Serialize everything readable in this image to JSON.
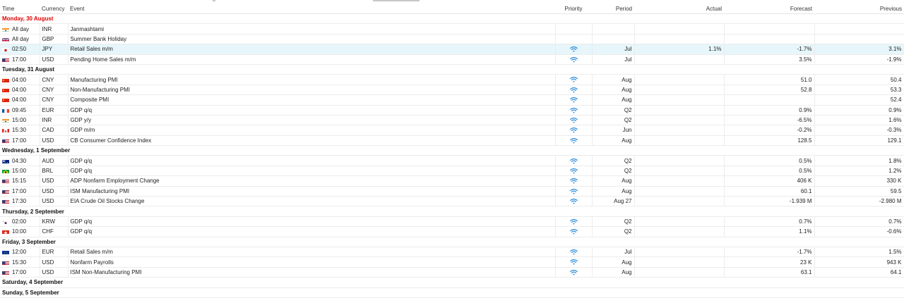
{
  "columns": {
    "time": "Time",
    "currency": "Currency",
    "event": "Event",
    "priority": "Priority",
    "period": "Period",
    "actual": "Actual",
    "forecast": "Forecast",
    "previous": "Previous"
  },
  "days": [
    {
      "label": "Monday, 30 August",
      "today": true,
      "events": [
        {
          "flag": "india",
          "time": "All day",
          "currency": "INR",
          "event": "Janmashtami",
          "priority": "",
          "period": "",
          "actual": "",
          "forecast": "",
          "previous": ""
        },
        {
          "flag": "uk",
          "time": "All day",
          "currency": "GBP",
          "event": "Summer Bank Holiday",
          "priority": "",
          "period": "",
          "actual": "",
          "forecast": "",
          "previous": ""
        },
        {
          "flag": "japan",
          "time": "02:50",
          "currency": "JPY",
          "event": "Retail Sales m/m",
          "priority": "high",
          "period": "Jul",
          "actual": "1.1%",
          "forecast": "-1.7%",
          "previous": "3.1%",
          "selected": true
        },
        {
          "flag": "usa",
          "time": "17:00",
          "currency": "USD",
          "event": "Pending Home Sales m/m",
          "priority": "high",
          "period": "Jul",
          "actual": "",
          "forecast": "3.5%",
          "previous": "-1.9%"
        }
      ]
    },
    {
      "label": "Tuesday, 31 August",
      "events": [
        {
          "flag": "china",
          "time": "04:00",
          "currency": "CNY",
          "event": "Manufacturing PMI",
          "priority": "high",
          "period": "Aug",
          "actual": "",
          "forecast": "51.0",
          "previous": "50.4"
        },
        {
          "flag": "china",
          "time": "04:00",
          "currency": "CNY",
          "event": "Non-Manufacturing PMI",
          "priority": "high",
          "period": "Aug",
          "actual": "",
          "forecast": "52.8",
          "previous": "53.3"
        },
        {
          "flag": "china",
          "time": "04:00",
          "currency": "CNY",
          "event": "Composite PMI",
          "priority": "high",
          "period": "Aug",
          "actual": "",
          "forecast": "",
          "previous": "52.4"
        },
        {
          "flag": "eu-france",
          "time": "09:45",
          "currency": "EUR",
          "event": "GDP q/q",
          "priority": "high",
          "period": "Q2",
          "actual": "",
          "forecast": "0.9%",
          "previous": "0.9%"
        },
        {
          "flag": "india",
          "time": "15:00",
          "currency": "INR",
          "event": "GDP y/y",
          "priority": "high",
          "period": "Q2",
          "actual": "",
          "forecast": "-6.5%",
          "previous": "1.6%"
        },
        {
          "flag": "canada",
          "time": "15:30",
          "currency": "CAD",
          "event": "GDP m/m",
          "priority": "high",
          "period": "Jun",
          "actual": "",
          "forecast": "-0.2%",
          "previous": "-0.3%"
        },
        {
          "flag": "usa",
          "time": "17:00",
          "currency": "USD",
          "event": "CB Consumer Confidence Index",
          "priority": "high",
          "period": "Aug",
          "actual": "",
          "forecast": "128.5",
          "previous": "129.1"
        }
      ]
    },
    {
      "label": "Wednesday, 1 September",
      "events": [
        {
          "flag": "australia",
          "time": "04:30",
          "currency": "AUD",
          "event": "GDP q/q",
          "priority": "high",
          "period": "Q2",
          "actual": "",
          "forecast": "0.5%",
          "previous": "1.8%"
        },
        {
          "flag": "brazil",
          "time": "15:00",
          "currency": "BRL",
          "event": "GDP q/q",
          "priority": "high",
          "period": "Q2",
          "actual": "",
          "forecast": "0.5%",
          "previous": "1.2%"
        },
        {
          "flag": "usa",
          "time": "15:15",
          "currency": "USD",
          "event": "ADP Nonfarm Employment Change",
          "priority": "high",
          "period": "Aug",
          "actual": "",
          "forecast": "406 K",
          "previous": "330 K"
        },
        {
          "flag": "usa",
          "time": "17:00",
          "currency": "USD",
          "event": "ISM Manufacturing PMI",
          "priority": "high",
          "period": "Aug",
          "actual": "",
          "forecast": "60.1",
          "previous": "59.5"
        },
        {
          "flag": "usa",
          "time": "17:30",
          "currency": "USD",
          "event": "EIA Crude Oil Stocks Change",
          "priority": "high",
          "period": "Aug 27",
          "actual": "",
          "forecast": "-1.939 M",
          "previous": "-2.980 M"
        }
      ]
    },
    {
      "label": "Thursday, 2 September",
      "events": [
        {
          "flag": "korea",
          "time": "02:00",
          "currency": "KRW",
          "event": "GDP q/q",
          "priority": "high",
          "period": "Q2",
          "actual": "",
          "forecast": "0.7%",
          "previous": "0.7%"
        },
        {
          "flag": "swiss",
          "time": "10:00",
          "currency": "CHF",
          "event": "GDP q/q",
          "priority": "high",
          "period": "Q2",
          "actual": "",
          "forecast": "1.1%",
          "previous": "-0.6%"
        }
      ]
    },
    {
      "label": "Friday, 3 September",
      "events": [
        {
          "flag": "eu",
          "time": "12:00",
          "currency": "EUR",
          "event": "Retail Sales m/m",
          "priority": "high",
          "period": "Jul",
          "actual": "",
          "forecast": "-1.7%",
          "previous": "1.5%"
        },
        {
          "flag": "usa",
          "time": "15:30",
          "currency": "USD",
          "event": "Nonfarm Payrolls",
          "priority": "high",
          "period": "Aug",
          "actual": "",
          "forecast": "23 K",
          "previous": "943 K"
        },
        {
          "flag": "usa",
          "time": "17:00",
          "currency": "USD",
          "event": "ISM Non-Manufacturing PMI",
          "priority": "high",
          "period": "Aug",
          "actual": "",
          "forecast": "63.1",
          "previous": "64.1"
        }
      ]
    },
    {
      "label": "Saturday, 4 September",
      "events": []
    },
    {
      "label": "Sunday, 5 September",
      "events": []
    }
  ],
  "colors": {
    "today": "#e00000",
    "priority": "#2a8ad8",
    "selected": "#e6f6fb"
  }
}
